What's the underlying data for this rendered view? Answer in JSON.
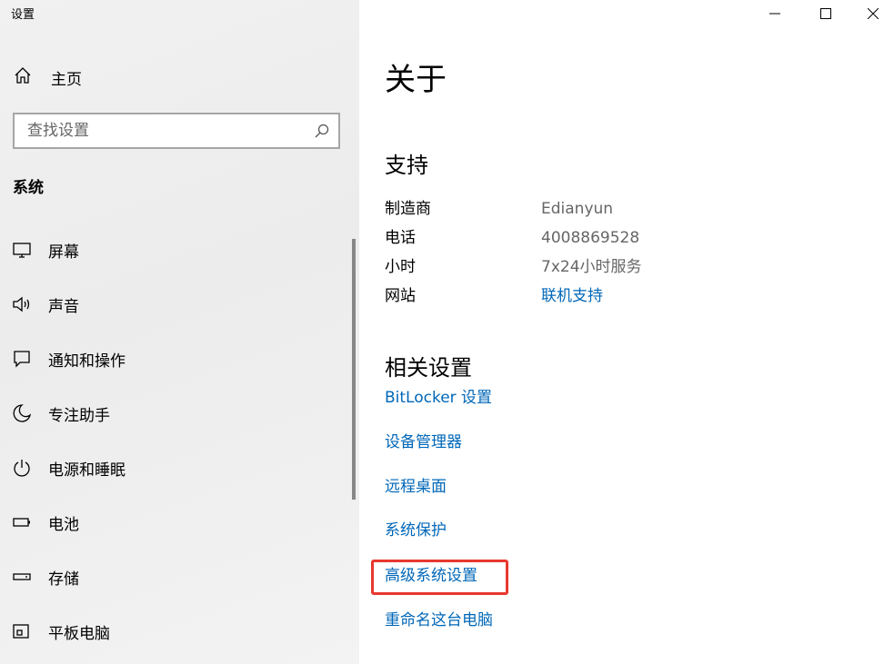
{
  "window": {
    "title": "设置",
    "controls": [
      "minimize",
      "maximize",
      "close"
    ]
  },
  "sidebar": {
    "home_label": "主页",
    "search_placeholder": "查找设置",
    "section_title": "系统",
    "items": [
      {
        "label": "屏幕",
        "icon": "monitor-icon"
      },
      {
        "label": "声音",
        "icon": "speaker-icon"
      },
      {
        "label": "通知和操作",
        "icon": "notification-icon"
      },
      {
        "label": "专注助手",
        "icon": "moon-icon"
      },
      {
        "label": "电源和睡眠",
        "icon": "power-icon"
      },
      {
        "label": "电池",
        "icon": "battery-icon"
      },
      {
        "label": "存储",
        "icon": "storage-icon"
      },
      {
        "label": "平板电脑",
        "icon": "tablet-icon"
      }
    ]
  },
  "main": {
    "title": "关于",
    "support": {
      "heading": "支持",
      "rows": [
        {
          "key": "制造商",
          "value": "Edianyun"
        },
        {
          "key": "电话",
          "value": "4008869528"
        },
        {
          "key": "小时",
          "value": "7x24小时服务"
        },
        {
          "key": "网站",
          "value": "联机支持"
        }
      ]
    },
    "related": {
      "heading": "相关设置",
      "links": [
        "BitLocker 设置",
        "设备管理器",
        "远程桌面",
        "系统保护",
        "高级系统设置",
        "重命名这台电脑"
      ]
    }
  },
  "colors": {
    "link": "#0067b8",
    "highlight": "#e8382f",
    "secondary_text": "#666666"
  }
}
